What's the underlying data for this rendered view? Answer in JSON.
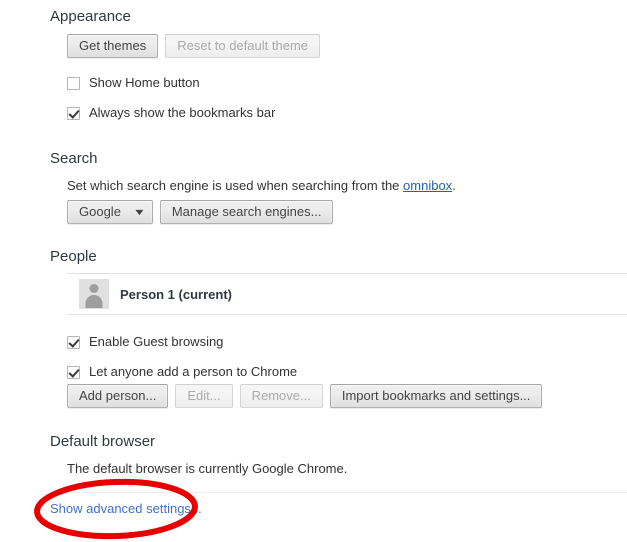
{
  "appearance": {
    "heading": "Appearance",
    "get_themes_label": "Get themes",
    "reset_theme_label": "Reset to default theme",
    "show_home_button_label": "Show Home button",
    "show_home_button_checked": false,
    "bookmarks_bar_label": "Always show the bookmarks bar",
    "bookmarks_bar_checked": true
  },
  "search": {
    "heading": "Search",
    "description_prefix": "Set which search engine is used when searching from the ",
    "description_link": "omnibox",
    "description_suffix": ".",
    "engine_selected": "Google",
    "dropdown_arrow": "▼",
    "manage_engines_label": "Manage search engines..."
  },
  "people": {
    "heading": "People",
    "person_name": "Person 1 (current)",
    "avatar_icon": "person-avatar-icon",
    "enable_guest_label": "Enable Guest browsing",
    "enable_guest_checked": true,
    "let_anyone_add_label": "Let anyone add a person to Chrome",
    "let_anyone_add_checked": true,
    "add_person_label": "Add person...",
    "edit_label": "Edit...",
    "remove_label": "Remove...",
    "import_label": "Import bookmarks and settings..."
  },
  "default_browser": {
    "heading": "Default browser",
    "status_text": "The default browser is currently Google Chrome."
  },
  "advanced": {
    "show_advanced_label": "Show advanced settings..."
  },
  "annotation": {
    "shape": "red-ellipse-highlight",
    "color": "#e60000"
  },
  "colors": {
    "heading": "#303942",
    "body": "#333333",
    "link": "#2a5db0",
    "plain_link": "#4070cf",
    "annotation_red": "#e60000",
    "button_face": "#ededed",
    "disabled_text": "#aaaaaa"
  }
}
